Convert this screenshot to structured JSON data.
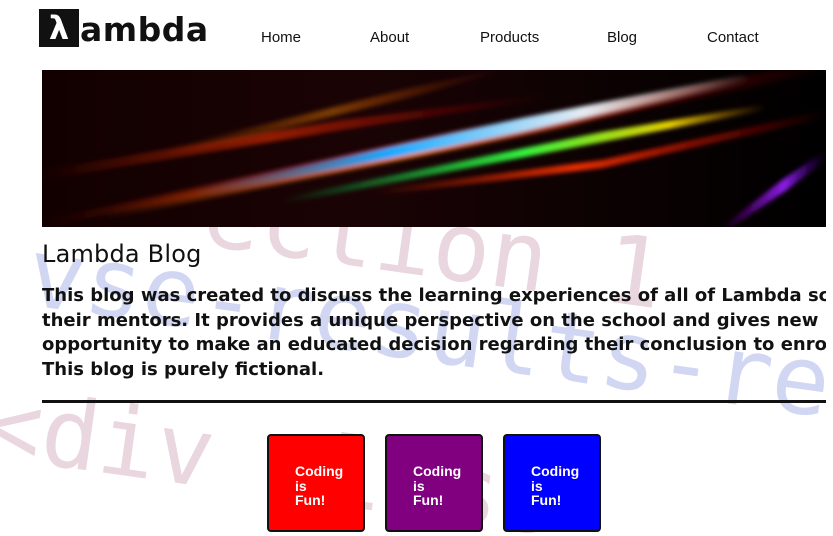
{
  "logo": {
    "mark": "λ",
    "text": "ambda"
  },
  "nav": {
    "items": [
      "Home",
      "About",
      "Products",
      "Blog",
      "Contact"
    ]
  },
  "main": {
    "title": "Lambda Blog",
    "intro_lines": [
      "This blog was created to discuss the learning experiences of all of Lambda school's cohorts and",
      "their mentors. It provides a unique perspective on the school and gives new potential cohorts the",
      "opportunity to make an educated decision regarding their conclusion to enroll in Lambda school.",
      "This blog is purely fictional."
    ]
  },
  "cards": [
    {
      "lines": [
        "Coding",
        "is",
        "Fun!"
      ],
      "color": "#ff0000"
    },
    {
      "lines": [
        "Coding",
        "is",
        "Fun!"
      ],
      "color": "#800080"
    },
    {
      "lines": [
        "Coding",
        "is",
        "Fun!"
      ],
      "color": "#0000ff"
    }
  ]
}
